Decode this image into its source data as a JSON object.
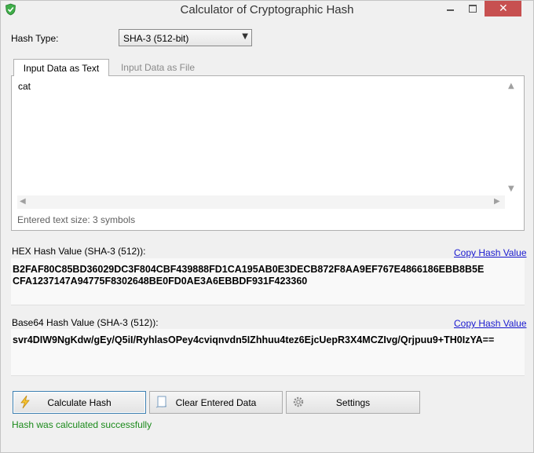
{
  "window": {
    "title": "Calculator of Cryptographic Hash",
    "close_icon": "close-icon"
  },
  "hash_type": {
    "label": "Hash Type:",
    "selected": "SHA-3 (512-bit)"
  },
  "tabs": [
    {
      "label": "Input Data as Text",
      "active": true
    },
    {
      "label": "Input Data as File",
      "active": false
    }
  ],
  "input": {
    "text": "cat",
    "size_label": "Entered text size: 3 symbols"
  },
  "hex": {
    "label": "HEX Hash Value (SHA-3 (512)):",
    "copy_link": "Copy Hash Value",
    "line1": "B2FAF80C85BD36029DC3F804CBF439888FD1CA195AB0E3DECB872F8AA9EF767E4866186EBB8B5E",
    "line2": "CFA1237147A94775F8302648BE0FD0AE3A6EBBDF931F423360"
  },
  "base64": {
    "label": "Base64 Hash Value (SHA-3 (512)):",
    "copy_link": "Copy Hash Value",
    "value": "svr4DIW9NgKdw/gEy/Q5iI/RyhlasOPey4cviqnvdn5IZhhuu4tez6EjcUepR3X4MCZIvg/Qrjpuu9+TH0IzYA=="
  },
  "buttons": {
    "calculate": "Calculate Hash",
    "clear": "Clear Entered Data",
    "settings": "Settings"
  },
  "status": "Hash was calculated successfully",
  "colors": {
    "status": "#1a8a1a",
    "link": "#1a1ad0",
    "close_button": "#c75050"
  }
}
